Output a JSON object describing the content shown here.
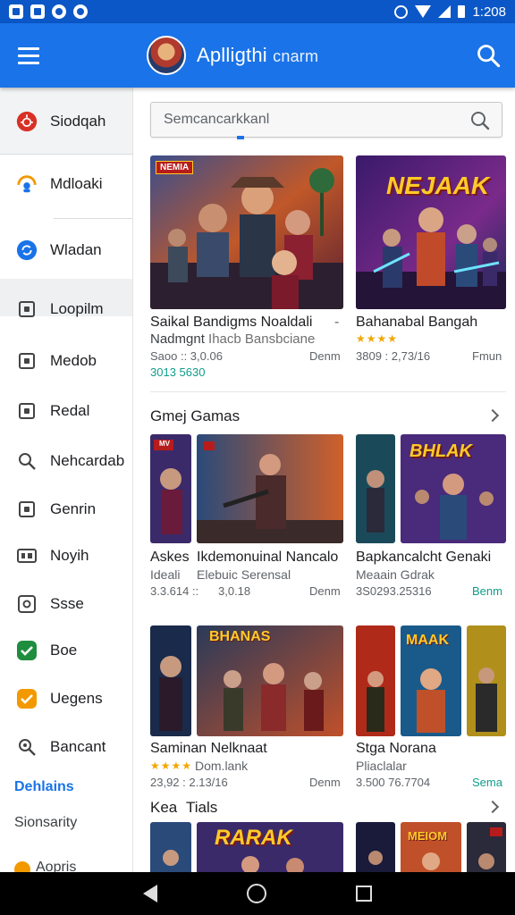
{
  "status_bar": {
    "time": "1:208"
  },
  "app_bar": {
    "title": "Aplligthi",
    "title_suffix": "cnarm"
  },
  "drawer": {
    "items": [
      {
        "label": "Siodqah",
        "icon": "bug-icon",
        "color": "#d93025"
      },
      {
        "label": "Mdloaki",
        "icon": "cloud-person-icon",
        "color": "#f29900"
      },
      {
        "label": "Wladan",
        "icon": "sync-icon",
        "color": "#1a73e8"
      },
      {
        "label": "Loopilm",
        "icon": "grid-icon",
        "color": "#5f6368"
      },
      {
        "label": "Medob",
        "icon": "square-icon",
        "color": "#5f6368"
      },
      {
        "label": "Redal",
        "icon": "calendar-icon",
        "color": "#5f6368"
      },
      {
        "label": "Nehcardab",
        "icon": "search-icon",
        "color": "#5f6368"
      },
      {
        "label": "Genrin",
        "icon": "folder-icon",
        "color": "#5f6368"
      },
      {
        "label": "Noyih",
        "icon": "apps-icon",
        "color": "#5f6368"
      },
      {
        "label": "Ssse",
        "icon": "settings-square-icon",
        "color": "#5f6368"
      },
      {
        "label": "Boe",
        "icon": "check-circle-icon",
        "color": "#1e8e3e"
      },
      {
        "label": "Uegens",
        "icon": "shield-check-icon",
        "color": "#f29900"
      },
      {
        "label": "Bancant",
        "icon": "magnify-icon",
        "color": "#5f6368"
      }
    ],
    "section_header": "Dehlains",
    "section_items": [
      "Sionsarity",
      "Aopris"
    ]
  },
  "search": {
    "placeholder": "Semcancarkkanl"
  },
  "featured": [
    {
      "badge": "NEMIA",
      "title": "Saikal Bandigms Noaldali",
      "title_extra": "-",
      "subtitle": "Nadmgnt",
      "subtitle_faded": "Ihacb Bansbciane",
      "meta": "Saoo :: 3,0.06",
      "price": "Denm",
      "extra": "3013 5630"
    },
    {
      "badge": "NEJAAK",
      "title": "Bahanabal Bangah",
      "rating": "★★★★",
      "meta": "3809 : 2,73/16",
      "price": "Fmun"
    }
  ],
  "section1": {
    "title": "Gmej Gamas",
    "items": [
      {
        "title": "Askes",
        "subtitle": "Ideali",
        "meta": "3.3.614 ::",
        "badge": "MV"
      },
      {
        "title": "Ikdemonuinal Nancalo",
        "subtitle": "Elebuic Serensal",
        "meta": "3,0.18",
        "price": "Denm"
      },
      {
        "title": "Bapkancalcht Genaki",
        "subtitle": "Meaain Gdrak",
        "meta": "3S0293.25316",
        "price": "Benm",
        "badge": "BHLAK"
      }
    ]
  },
  "section2": {
    "items": [
      {
        "title": "Saminan Nelknaat",
        "rating": "★★★★",
        "subtitle": "Dom.lank",
        "meta": "23,92 : 2.13/16",
        "price": "Denm",
        "badge": "BHANAS"
      },
      {
        "title": "Stga Norana",
        "subtitle": "Pliaclalar",
        "meta": "3.500 76.7704",
        "price": "Sema",
        "badge": "MAAK"
      }
    ]
  },
  "section3": {
    "title": "Kea",
    "title2": "Tials",
    "badge": "RARAK",
    "badge2": "MEIOM"
  }
}
